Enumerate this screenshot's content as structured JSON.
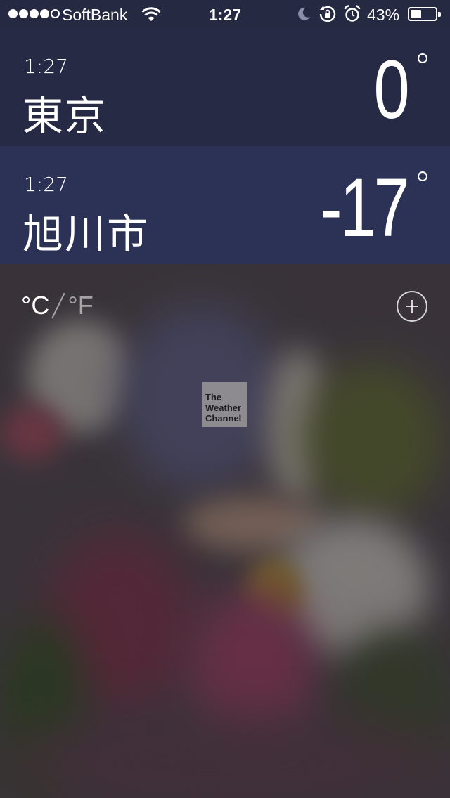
{
  "status_bar": {
    "signal_bars_filled": 4,
    "signal_bars_total": 5,
    "carrier": "SoftBank",
    "time": "1:27",
    "battery_percent": "43%",
    "battery_level": 0.43,
    "icons": [
      "wifi-icon",
      "moon-icon",
      "rotation-lock-icon",
      "alarm-icon",
      "battery-icon"
    ]
  },
  "cities": [
    {
      "time": "1:27",
      "name": "東京",
      "temperature": "0"
    },
    {
      "time": "1:27",
      "name": "旭川市",
      "temperature": "-17"
    }
  ],
  "units": {
    "celsius": "°C",
    "fahrenheit": "°F",
    "selected": "celsius"
  },
  "add_button_icon": "plus-circle-icon",
  "logo": {
    "line1": "The",
    "line2": "Weather",
    "line3": "Channel"
  },
  "colors": {
    "row1_bg": "#262a44",
    "row2_bg": "#2c3256",
    "text": "#ffffff"
  }
}
